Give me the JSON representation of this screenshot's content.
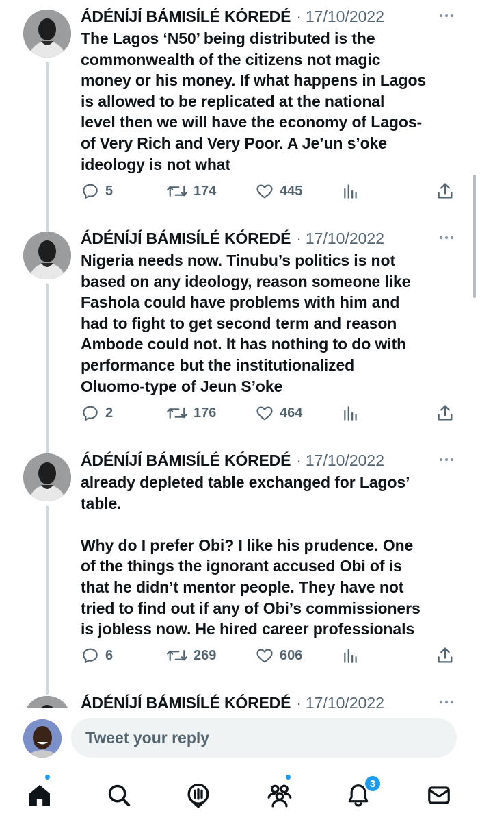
{
  "tweets": [
    {
      "author": "ÁDÉNÍJÍ BÁMISÍLÉ KÓREDÉ",
      "separator": "·",
      "date": "17/10/2022",
      "text": "The Lagos ‘N50’ being distributed is the\ncommonwealth of the citizens not magic\nmoney or his money. If what happens in Lagos\nis allowed to be replicated at the national\nlevel then we will have the economy of Lagos-\nof Very Rich and Very Poor. A Je’un s’oke\nideology is not what",
      "replies": "5",
      "retweets": "174",
      "likes": "445"
    },
    {
      "author": "ÁDÉNÍJÍ BÁMISÍLÉ KÓREDÉ",
      "separator": "·",
      "date": "17/10/2022",
      "text": "Nigeria needs now. Tinubu’s politics is not\nbased on any ideology, reason someone like\nFashola could have problems with him and\nhad to fight to get second term and reason\nAmbode could not. It has nothing to do with\nperformance but the institutionalized\nOluomo-type of Jeun S’oke",
      "replies": "2",
      "retweets": "176",
      "likes": "464"
    },
    {
      "author": "ÁDÉNÍJÍ BÁMISÍLÉ KÓREDÉ",
      "separator": "·",
      "date": "17/10/2022",
      "text": "already depleted table exchanged for Lagos’\ntable.\n\nWhy do I prefer Obi? I like his prudence. One\nof the things the ignorant accused Obi of is\nthat he didn’t mentor people. They have not\ntried to find out if any of Obi’s commissioners\nis jobless now. He hired career professionals",
      "replies": "6",
      "retweets": "269",
      "likes": "606"
    },
    {
      "author": "ÁDÉNÍJÍ BÁMISÍLÉ KÓREDÉ",
      "separator": "·",
      "date": "17/10/2022"
    }
  ],
  "reply": {
    "placeholder": "Tweet your reply"
  },
  "tabbar": {
    "notifications_badge": "3"
  },
  "colors": {
    "accent": "#1d9bf0",
    "text_primary": "#0f1419",
    "text_secondary": "#536471",
    "thread_line": "#cfd9de",
    "input_bg": "#eff3f4"
  }
}
